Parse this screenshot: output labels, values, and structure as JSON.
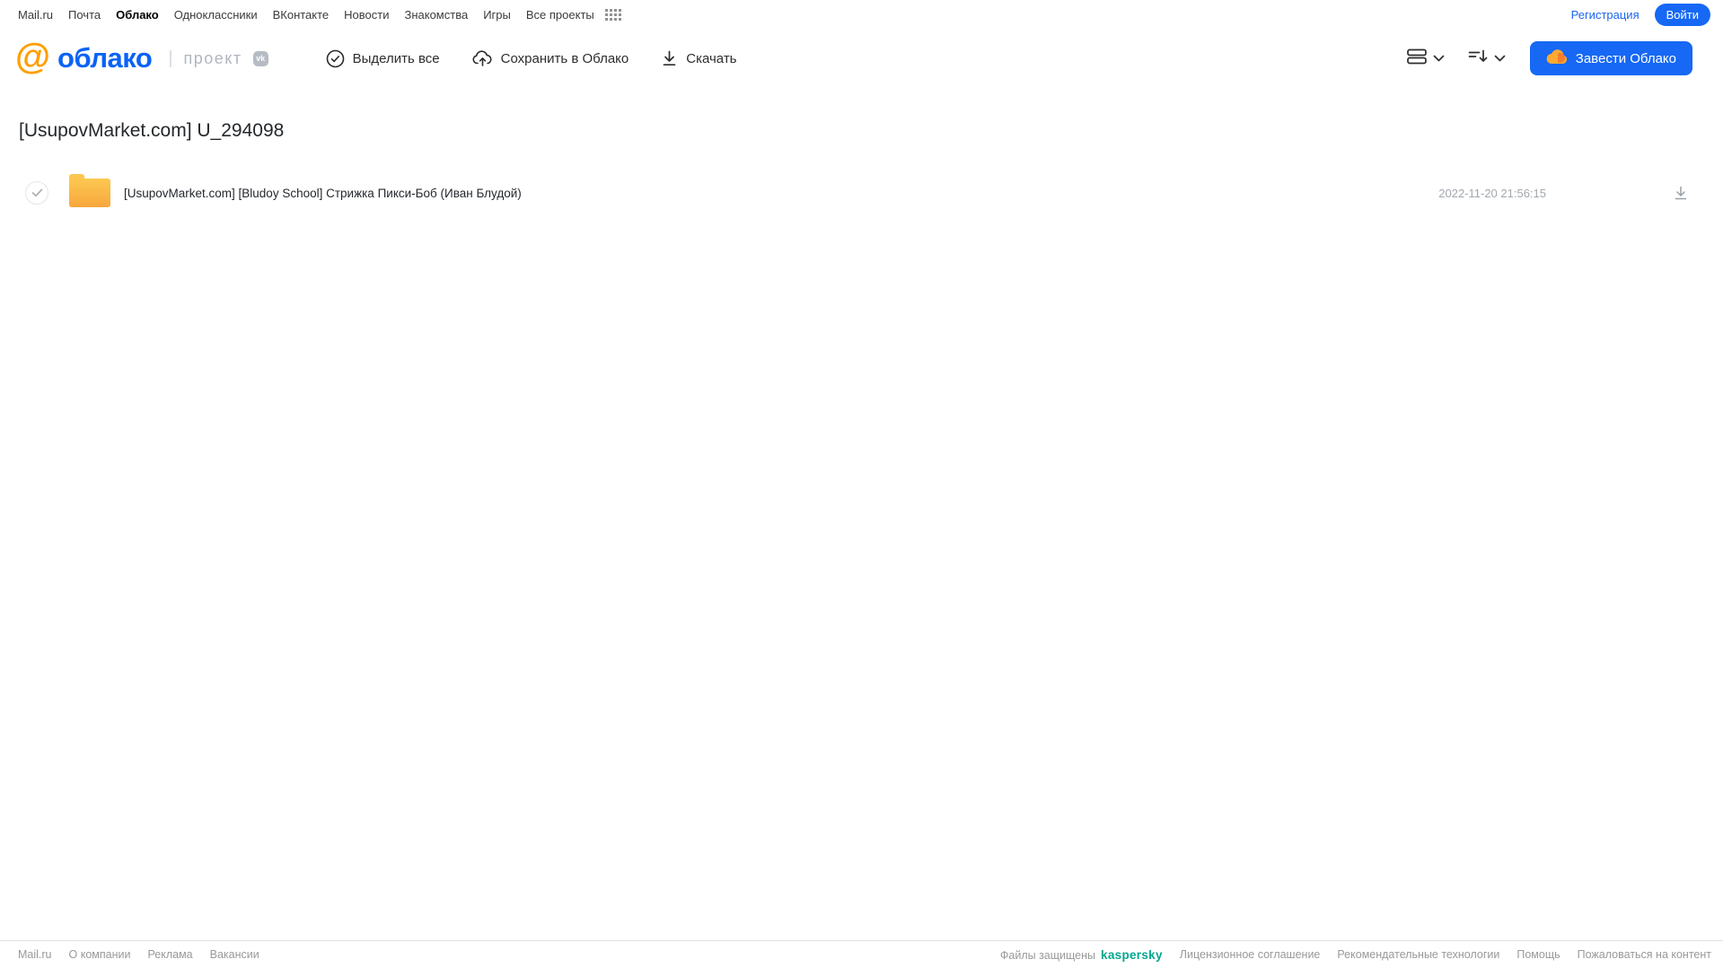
{
  "topnav": {
    "items": [
      {
        "label": "Mail.ru",
        "active": false
      },
      {
        "label": "Почта",
        "active": false
      },
      {
        "label": "Облако",
        "active": true
      },
      {
        "label": "Одноклассники",
        "active": false
      },
      {
        "label": "ВКонтакте",
        "active": false
      },
      {
        "label": "Новости",
        "active": false
      },
      {
        "label": "Знакомства",
        "active": false
      },
      {
        "label": "Игры",
        "active": false
      },
      {
        "label": "Все проекты",
        "active": false
      }
    ],
    "registration_label": "Регистрация",
    "login_label": "Войти"
  },
  "header": {
    "logo_at": "@",
    "logo_text": "облако",
    "logo_divider": "|",
    "project_label": "проект",
    "vk_badge": "vk",
    "toolbar": [
      {
        "label": "Выделить все",
        "icon": "check-circle-icon"
      },
      {
        "label": "Сохранить в Облако",
        "icon": "cloud-upload-icon"
      },
      {
        "label": "Скачать",
        "icon": "download-icon"
      }
    ],
    "view_icon": "list-view-icon",
    "sort_icon": "sort-icon",
    "create_cloud_label": "Завести Облако"
  },
  "content": {
    "title": "[UsupovMarket.com] U_294098",
    "files": [
      {
        "type": "folder",
        "name": "[UsupovMarket.com] [Bludoy School] Стрижка Пикси-Боб (Иван Блудой)",
        "date": "2022-11-20 21:56:15"
      }
    ]
  },
  "footer": {
    "left_links": [
      "Mail.ru",
      "О компании",
      "Реклама",
      "Вакансии"
    ],
    "protected_label": "Файлы защищены",
    "kaspersky_label": "kaspersky",
    "right_links": [
      "Лицензионное соглашение",
      "Рекомендательные технологии",
      "Помощь",
      "Пожаловаться на контент"
    ]
  },
  "colors": {
    "accent_blue": "#1668f5",
    "logo_orange": "#ff9e00",
    "logo_blue": "#0b63f6",
    "kaspersky_teal": "#00a88e",
    "folder_top": "#fdc851",
    "folder_bottom": "#f7a73d",
    "footer_gray": "#999999"
  }
}
